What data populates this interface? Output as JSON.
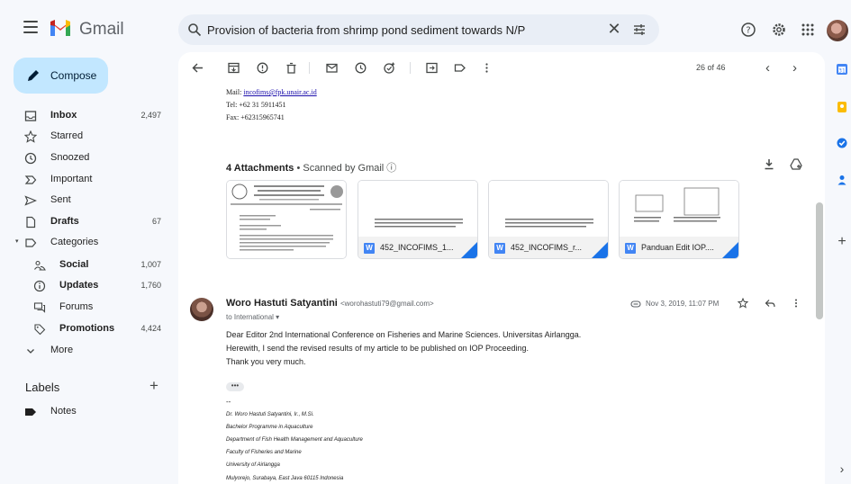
{
  "app": {
    "name": "Gmail"
  },
  "search": {
    "value": "Provision of bacteria from shrimp pond sediment towards N/P",
    "clear_glyph": "✕"
  },
  "compose": {
    "label": "Compose"
  },
  "nav": [
    {
      "label": "Inbox",
      "count": "2,497",
      "bold": true,
      "icon": "inbox-icon"
    },
    {
      "label": "Starred",
      "count": "",
      "bold": false,
      "icon": "star-icon"
    },
    {
      "label": "Snoozed",
      "count": "",
      "bold": false,
      "icon": "clock-icon"
    },
    {
      "label": "Important",
      "count": "",
      "bold": false,
      "icon": "important-icon"
    },
    {
      "label": "Sent",
      "count": "",
      "bold": false,
      "icon": "send-icon"
    },
    {
      "label": "Drafts",
      "count": "67",
      "bold": true,
      "icon": "draft-icon"
    },
    {
      "label": "Categories",
      "count": "",
      "bold": false,
      "icon": "label-icon"
    },
    {
      "label": "Social",
      "count": "1,007",
      "bold": true,
      "icon": "people-icon",
      "sub": true
    },
    {
      "label": "Updates",
      "count": "1,760",
      "bold": true,
      "icon": "info-icon",
      "sub": true
    },
    {
      "label": "Forums",
      "count": "",
      "bold": false,
      "icon": "forum-icon",
      "sub": true
    },
    {
      "label": "Promotions",
      "count": "4,424",
      "bold": true,
      "icon": "tag-icon",
      "sub": true
    },
    {
      "label": "More",
      "count": "",
      "bold": false,
      "icon": "chevron-down-icon"
    }
  ],
  "labels": {
    "heading": "Labels",
    "add": "+",
    "items": [
      {
        "label": "Notes"
      }
    ]
  },
  "toolbar": {
    "pager": "26 of 46",
    "prev": "‹",
    "next": "›"
  },
  "prev_signature": {
    "mail_label": "Mail: ",
    "mail_link": "incofims@fpk.unair.ac.id",
    "tel": "Tel: +62 31 5911451",
    "fax": "Fax: +62315965741"
  },
  "attachments": {
    "title": "4 Attachments",
    "scanned": " • Scanned by Gmail ⓘ",
    "files": [
      {
        "name": "",
        "icon": ""
      },
      {
        "name": "452_INCOFIMS_1...",
        "icon": "W"
      },
      {
        "name": "452_INCOFIMS_r...",
        "icon": "W"
      },
      {
        "name": "Panduan Edit IOP....",
        "icon": "W"
      }
    ]
  },
  "message": {
    "sender": "Woro Hastuti Satyantini",
    "email": "<worohastuti79@gmail.com>",
    "to": "to International ▾",
    "date": "Nov 3, 2019, 11:07 PM",
    "body": [
      "Dear Editor 2nd International Conference on Fisheries and Marine Sciences. Universitas Airlangga.",
      "Herewith, I send the revised results of my article to be published on IOP Proceeding.",
      "Thank you very much."
    ],
    "ellipsis": "•••",
    "signature": [
      "--",
      "Dr. Woro Hastuti Satyantini, Ir., M.Si.",
      "Bachelor Programme in Aquaculture",
      "Department of Fish Health Management and Aquaculture",
      "Faculty of Fisheries and Marine",
      "University of Airlangga",
      "Mulyorejo, Surabaya, East Java 60115 Indonesia"
    ]
  },
  "colors": {
    "accent": "#1a73e8",
    "compose_bg": "#c2e7ff",
    "bg": "#f6f8fc"
  }
}
